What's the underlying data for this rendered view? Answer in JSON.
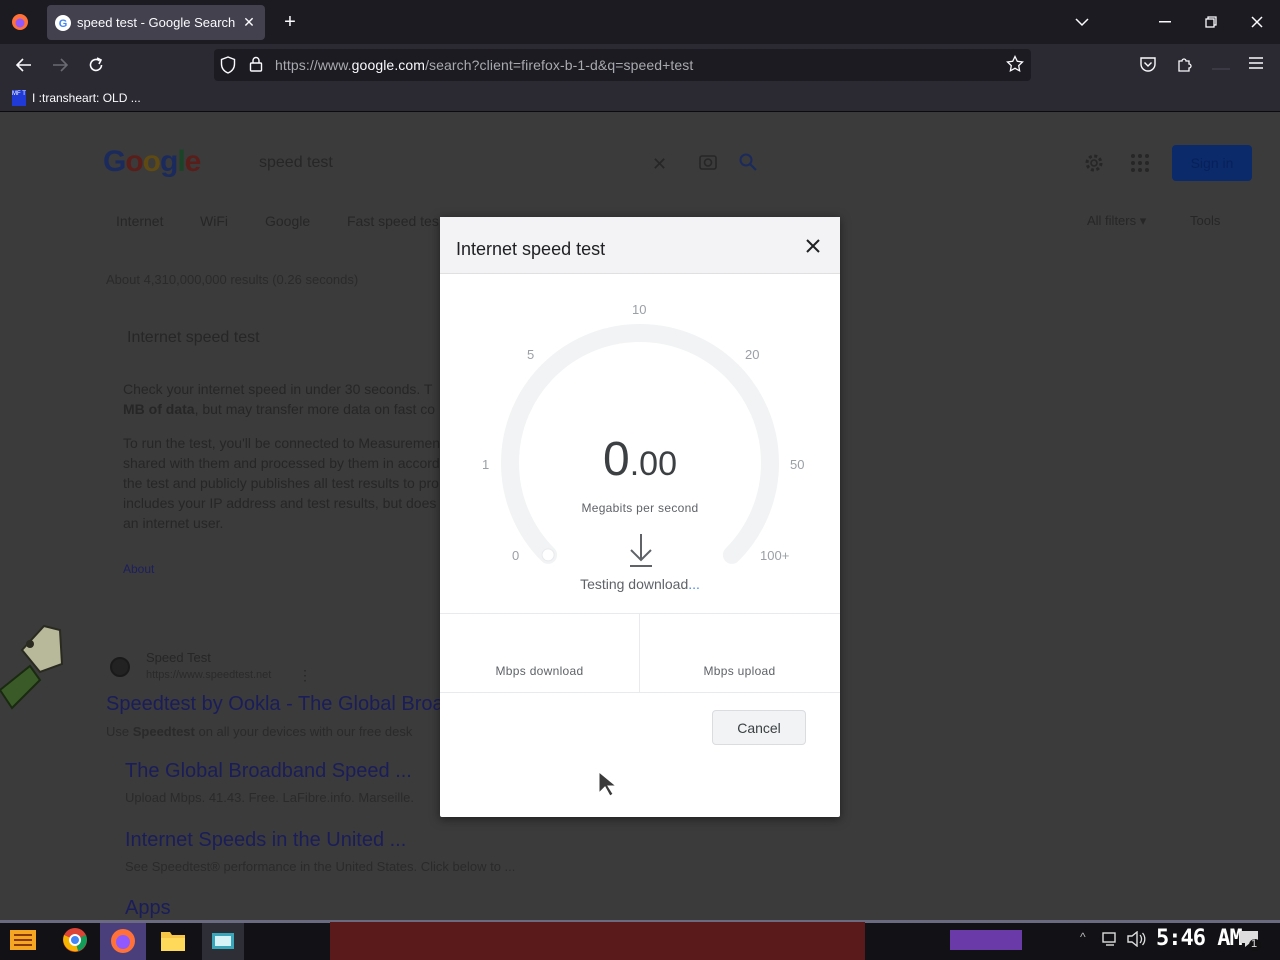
{
  "browser": {
    "tab_title": "speed test - Google Search",
    "url_prefix": "https://www.",
    "url_domain": "google.com",
    "url_path": "/search?client=firefox-b-1-d&q=speed+test",
    "bookmark_label": "I :transheart: OLD ...",
    "bookmark_icon_text": "MF T"
  },
  "page": {
    "search_query": "speed test",
    "signin_label": "Sign in",
    "chips": [
      "Internet",
      "WiFi",
      "Google",
      "Fast speed tes"
    ],
    "all_filters": "All filters",
    "tools": "Tools",
    "results_count": "About 4,310,000,000 results (0.26 seconds)",
    "snippet_title": "Internet speed test",
    "para1_line1": "Check your internet speed in under 30 seconds. T",
    "para1_line2_bold": "MB of data",
    "para1_line2_rest": ", but may transfer more data on fast co",
    "para2_lines": [
      "To run the test, you'll be connected to Measuremen",
      "shared with them and processed by them in accord",
      "the test and publicly publishes all test results to pro",
      "includes your IP address and test results, but does",
      "an internet user."
    ],
    "about_link": "About",
    "result1_site": "Speed Test",
    "result1_url": "https://www.speedtest.net",
    "result1_title": "Speedtest by Ookla - The Global Broa",
    "result1_desc_pre": "Use ",
    "result1_desc_bold": "Speedtest",
    "result1_desc_rest": " on all your devices with our free desk",
    "sub1_title": "The Global Broadband Speed ...",
    "sub1_desc": "Upload Mbps. 41.43. Free. LaFibre.info. Marseille.",
    "sub2_title": "Internet Speeds in the United ...",
    "sub2_desc": "See Speedtest® performance in the United States. Click below to ...",
    "sub3_title": "Apps"
  },
  "dialog": {
    "title": "Internet speed test",
    "gauge_ticks": [
      "0",
      "1",
      "5",
      "10",
      "20",
      "50",
      "100+"
    ],
    "speed_integer": "0",
    "speed_decimal": ".00",
    "speed_unit": "Megabits per second",
    "status_text": "Testing download",
    "status_dots": "...",
    "download_label": "Mbps download",
    "upload_label": "Mbps upload",
    "cancel_label": "Cancel",
    "gauge_progress": 0
  },
  "taskbar": {
    "clock": "5:46 AM",
    "notification_count": "1"
  },
  "colors": {
    "google_blue": "#4285f4",
    "firefox_dark": "#1c1b22",
    "dialog_bg": "#ffffff"
  }
}
